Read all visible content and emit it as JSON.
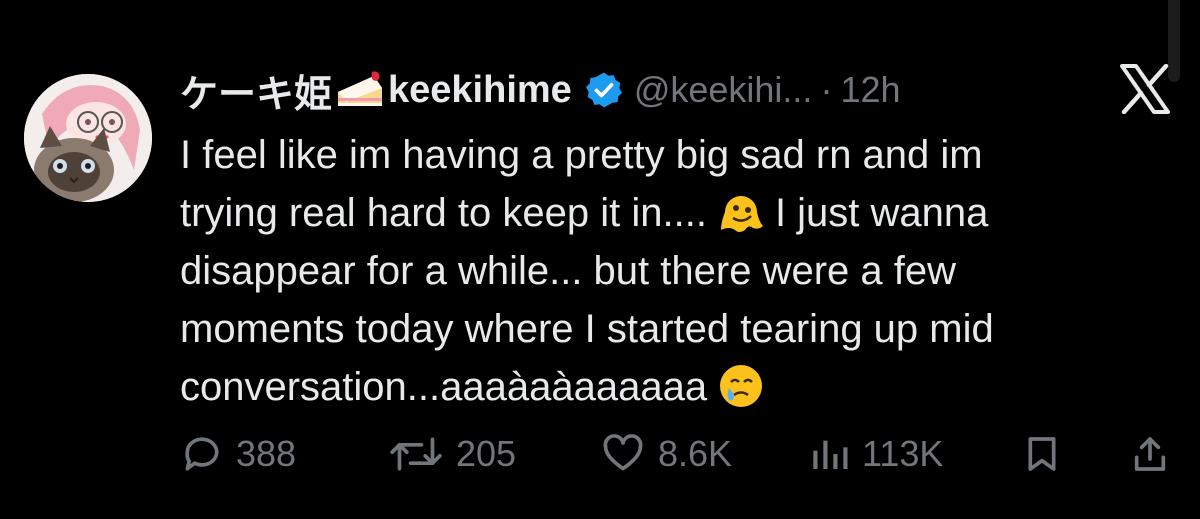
{
  "tweet": {
    "display_name": "ケーキ姫",
    "username": "keekihime",
    "handle": "@keekihi...",
    "separator": "·",
    "time": "12h",
    "lines": [
      "I feel like im having a pretty big sad rn and im",
      "trying real hard to keep it in....",
      "I just wanna",
      "disappear for a while... but there were a few",
      "moments today where I started tearing up mid",
      "conversation...aaaàaàaaaaaa"
    ],
    "emojis": [
      "melting-face-emoji",
      "face-holding-back-tears-emoji",
      "shortcake-emoji"
    ]
  },
  "actions": {
    "replies": "388",
    "reposts": "205",
    "likes": "8.6K",
    "views": "113K"
  },
  "colors": {
    "background": "#000000",
    "text": "#e7e9ea",
    "muted": "#71767b",
    "verified": "#1d9bf0"
  }
}
